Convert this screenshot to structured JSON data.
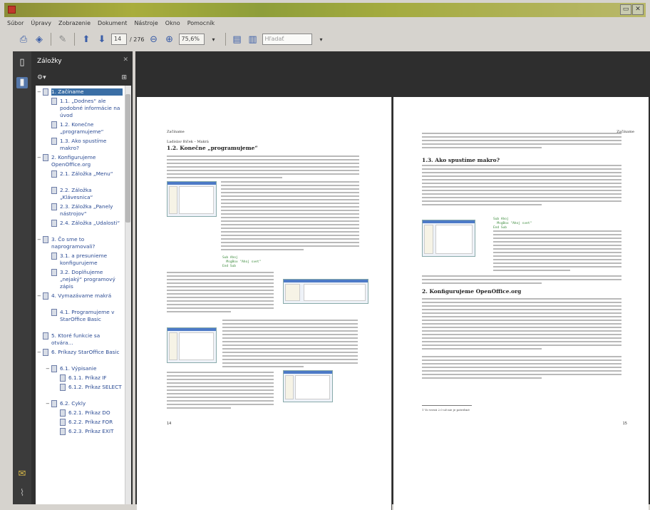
{
  "window": {
    "title": ""
  },
  "menu": [
    "Súbor",
    "Úpravy",
    "Zobrazenie",
    "Dokument",
    "Nástroje",
    "Okno",
    "Pomocník"
  ],
  "toolbar": {
    "page_current": "14",
    "page_total": "/ 276",
    "zoom": "75,6%",
    "search_placeholder": "Hľadať"
  },
  "bookmarks_panel": {
    "title": "Záložky",
    "items": [
      {
        "label": "1. Začíname",
        "level": 0,
        "toggle": "−",
        "selected": true
      },
      {
        "label": "1.1. „Dodnes“ ale podobné informácie na úvod",
        "level": 1,
        "toggle": ""
      },
      {
        "label": "1.2. Konečne „programujeme“",
        "level": 1,
        "toggle": ""
      },
      {
        "label": "1.3. Ako spustíme makro?",
        "level": 1,
        "toggle": ""
      },
      {
        "label": "2. Konfigurujeme OpenOffice.org",
        "level": 0,
        "toggle": "−"
      },
      {
        "label": "2.1. Záložka „Menu“",
        "level": 1,
        "toggle": ""
      },
      {
        "label": "2.2. Záložka „Klávesnica“",
        "level": 1,
        "toggle": ""
      },
      {
        "label": "2.3. Záložka „Panely nástrojov“",
        "level": 1,
        "toggle": ""
      },
      {
        "label": "2.4. Záložka „Udalosti“",
        "level": 1,
        "toggle": ""
      },
      {
        "label": "3. Čo sme to naprogramovali?",
        "level": 0,
        "toggle": "−"
      },
      {
        "label": "3.1. a presunieme konfigurujeme",
        "level": 1,
        "toggle": ""
      },
      {
        "label": "3.2. Doplňujeme „nejaký“ programový zápis",
        "level": 1,
        "toggle": ""
      },
      {
        "label": "4. Vymazávame makrá",
        "level": 0,
        "toggle": "−"
      },
      {
        "label": "4.1. Programujeme v StarOffice Basic",
        "level": 1,
        "toggle": ""
      },
      {
        "label": "5. Ktoré funkcie sa otvára...",
        "level": 0,
        "toggle": ""
      },
      {
        "label": "6. Príkazy StarOffice Basic",
        "level": 0,
        "toggle": "−"
      },
      {
        "label": "6.1. Výpisanie",
        "level": 1,
        "toggle": "−"
      },
      {
        "label": "6.1.1. Príkaz IF",
        "level": 2,
        "toggle": ""
      },
      {
        "label": "6.1.2. Príkaz SELECT",
        "level": 2,
        "toggle": ""
      },
      {
        "label": "6.2. Cykly",
        "level": 1,
        "toggle": "−"
      },
      {
        "label": "6.2.1. Príkaz DO",
        "level": 2,
        "toggle": ""
      },
      {
        "label": "6.2.2. Príkaz FOR",
        "level": 2,
        "toggle": ""
      },
      {
        "label": "6.2.3. Príkaz EXIT",
        "level": 2,
        "toggle": ""
      }
    ]
  },
  "left_page": {
    "running_head": "Začíname",
    "subhead": "Ladislav Biček – Makrá",
    "section": "1.2. Konečne „programujeme“",
    "code": "Sub Ahoj\n  MsgBox \"Ahoj svet\"\nEnd Sub",
    "page_number": "14"
  },
  "right_page": {
    "running_head": "Začíname",
    "section1": "1.3. Ako spustíme makro?",
    "code": "Sub Ahoj\n  MsgBox \"Ahoj svet\"\nEnd Sub",
    "section2": "2. Konfigurujeme OpenOffice.org",
    "footnote": "1 Vo verzii 2.0 už nie je potrebné",
    "page_number": "15"
  }
}
